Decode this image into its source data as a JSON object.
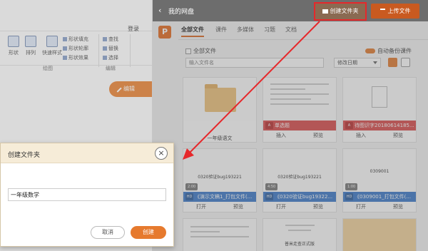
{
  "ribbon": {
    "login_label": "登录",
    "items": [
      {
        "label": "形状"
      },
      {
        "label": "排列"
      },
      {
        "label": "快速样式"
      }
    ],
    "small_items": [
      "形状填充",
      "形状轮廓",
      "形状效果"
    ],
    "edit_items": [
      "查找",
      "替换",
      "选择"
    ],
    "group_labels": [
      "绘图",
      "编辑"
    ],
    "edit_button": "编辑"
  },
  "cloud": {
    "title": "我的网盘",
    "mkdir_label": "创建文件夹",
    "upload_label": "上传文件",
    "tabs": [
      "全部文件",
      "课件",
      "多媒体",
      "习题",
      "文档"
    ],
    "all_files_label": "全部文件",
    "auto_backup_label": "自动备份课件",
    "search_placeholder": "输入文件名",
    "sort_value": "修改日期",
    "cards": [
      {
        "name": "一年级语文",
        "action1": "",
        "action2": ""
      },
      {
        "name": "单选题",
        "badge": "A",
        "action1": "插入",
        "action2": "预览"
      },
      {
        "name": "待图识字20180614185...",
        "badge": "A",
        "action1": "插入",
        "action2": "预览"
      },
      {
        "name": "《演示文稿1_打包文件(...",
        "badge": "HD",
        "duration": "2:00",
        "thumb_text": "0320验证bug193221",
        "action1": "打开",
        "action2": "预览"
      },
      {
        "name": "《0320验证bug19322...",
        "badge": "HD",
        "duration": "4:50",
        "thumb_text": "0320验证bug193221",
        "action1": "打开",
        "action2": "预览"
      },
      {
        "name": "《0309001_打包文件(...",
        "badge": "HD",
        "duration": "1:00",
        "thumb_text": "0309001",
        "action1": "打开",
        "action2": "预览"
      },
      {
        "thumb_text": "普米走查正式版"
      }
    ]
  },
  "dialog": {
    "title": "创建文件夹",
    "input_value": "一年级数学",
    "cancel_label": "取消",
    "create_label": "创建"
  },
  "colors": {
    "accent": "#e67a2e",
    "header": "#6d6d6d",
    "annotation": "#e6282b"
  }
}
